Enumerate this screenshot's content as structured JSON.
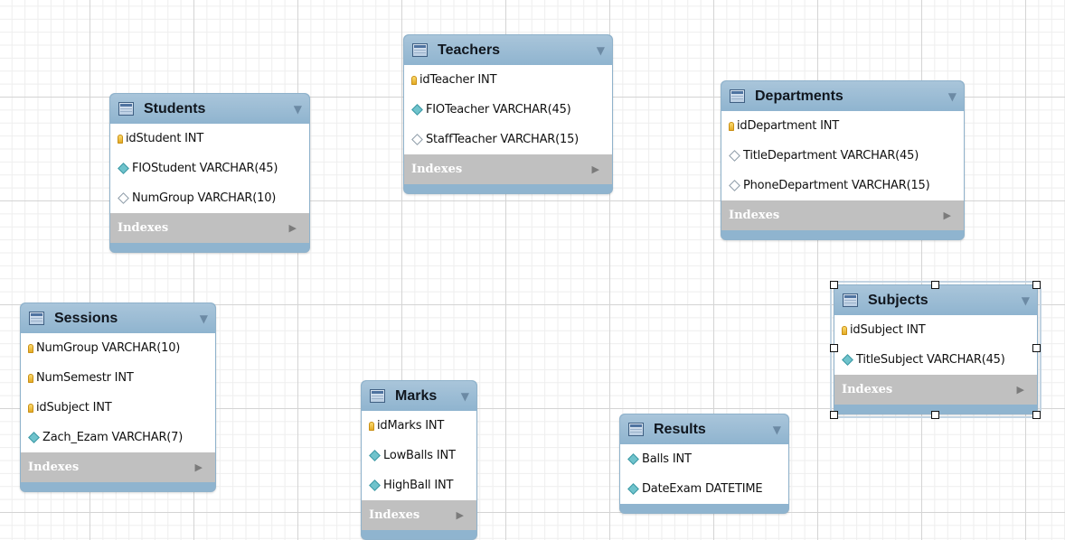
{
  "tables": [
    {
      "name": "Students",
      "columns": [
        {
          "text": "idStudent INT",
          "key": "pk"
        },
        {
          "text": "FIOStudent VARCHAR(45)",
          "key": "nn"
        },
        {
          "text": "NumGroup VARCHAR(10)",
          "key": "null"
        }
      ],
      "indexes_label": "Indexes",
      "selected": false
    },
    {
      "name": "Teachers",
      "columns": [
        {
          "text": "idTeacher INT",
          "key": "pk"
        },
        {
          "text": "FIOTeacher VARCHAR(45)",
          "key": "nn"
        },
        {
          "text": "StaffTeacher VARCHAR(15)",
          "key": "null"
        }
      ],
      "indexes_label": "Indexes",
      "selected": false
    },
    {
      "name": "Departments",
      "columns": [
        {
          "text": "idDepartment INT",
          "key": "pk"
        },
        {
          "text": "TitleDepartment VARCHAR(45)",
          "key": "null"
        },
        {
          "text": "PhoneDepartment VARCHAR(15)",
          "key": "null"
        }
      ],
      "indexes_label": "Indexes",
      "selected": false
    },
    {
      "name": "Sessions",
      "columns": [
        {
          "text": "NumGroup VARCHAR(10)",
          "key": "pk"
        },
        {
          "text": "NumSemestr INT",
          "key": "pk"
        },
        {
          "text": "idSubject INT",
          "key": "pk"
        },
        {
          "text": "Zach_Ezam VARCHAR(7)",
          "key": "nn"
        }
      ],
      "indexes_label": "Indexes",
      "selected": false
    },
    {
      "name": "Marks",
      "columns": [
        {
          "text": "idMarks INT",
          "key": "pk"
        },
        {
          "text": "LowBalls INT",
          "key": "nn"
        },
        {
          "text": "HighBall INT",
          "key": "nn"
        }
      ],
      "indexes_label": "Indexes",
      "selected": false
    },
    {
      "name": "Results",
      "columns": [
        {
          "text": "Balls INT",
          "key": "nn"
        },
        {
          "text": "DateExam DATETIME",
          "key": "nn"
        }
      ],
      "indexes_label": "",
      "selected": false
    },
    {
      "name": "Subjects",
      "columns": [
        {
          "text": "idSubject INT",
          "key": "pk"
        },
        {
          "text": "TitleSubject VARCHAR(45)",
          "key": "nn"
        }
      ],
      "indexes_label": "Indexes",
      "selected": true
    }
  ]
}
